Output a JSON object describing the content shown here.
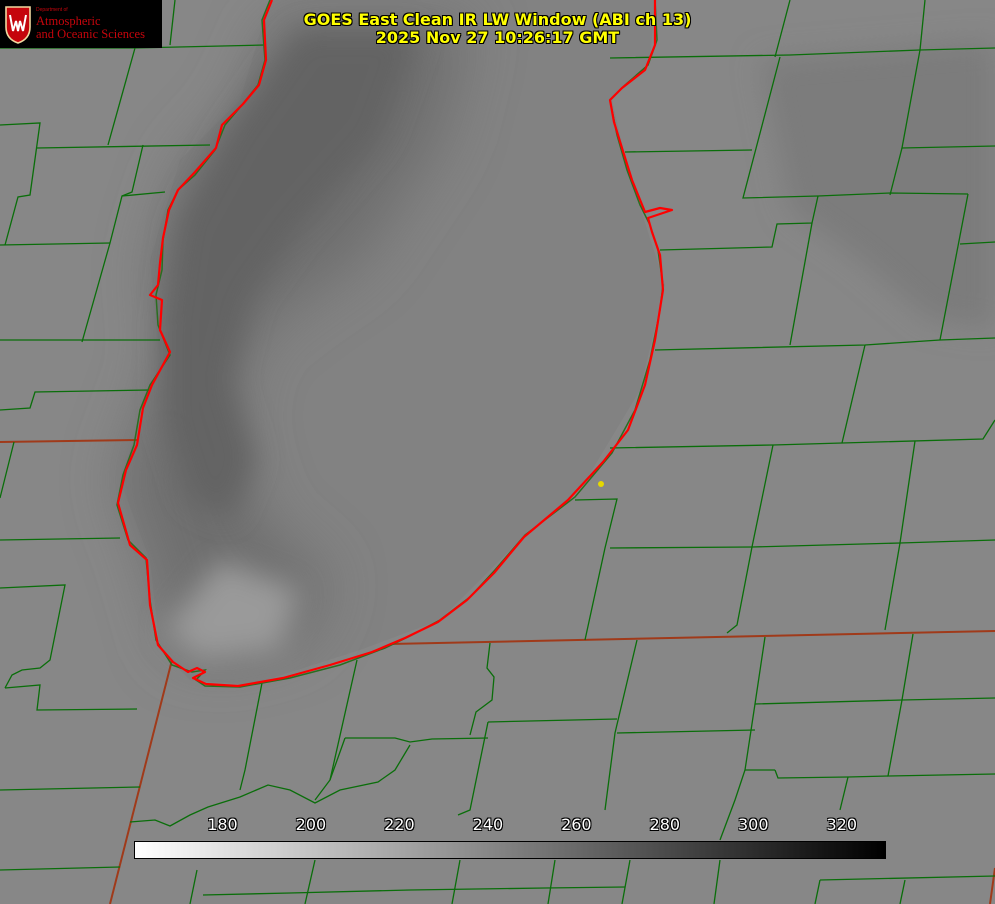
{
  "logo": {
    "department": "Department of",
    "line1": "Atmospheric",
    "line2": "and Oceanic Sciences"
  },
  "title": {
    "line1": "GOES East Clean IR LW Window (ABI ch 13)",
    "line2": "2025 Nov 27 10:26:17 GMT"
  },
  "colorbar": {
    "min": 160,
    "max": 330,
    "ticks": [
      "180",
      "200",
      "220",
      "240",
      "260",
      "280",
      "300",
      "320"
    ]
  },
  "colors": {
    "background": "#878787",
    "lake_shading": "#6f6f6f",
    "county_lines": "#006400",
    "state_lines": "#a03a1a",
    "lake_outline": "#ff0000",
    "title_text": "#ffff00",
    "logo_red": "#c5050c",
    "marker": "#e5d800"
  }
}
